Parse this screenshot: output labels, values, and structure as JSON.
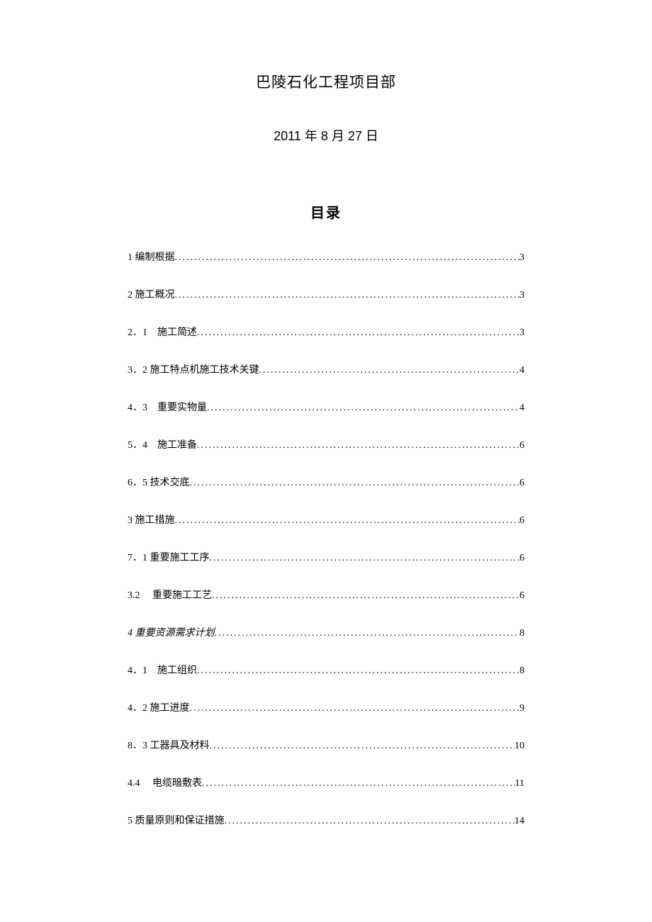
{
  "header": {
    "line1": "巴陵石化工程项目部",
    "line2": "2011 年 8 月 27 日"
  },
  "toc": {
    "title": "目录",
    "items": [
      {
        "label": "1 编制根据",
        "page": "3",
        "italic": false
      },
      {
        "label": "2 施工概况",
        "page": "3",
        "italic": false
      },
      {
        "label": "2．1　施工简述 ",
        "page": "3",
        "italic": false
      },
      {
        "label": "3．2 施工特点机施工技术关键",
        "page": "4",
        "italic": false
      },
      {
        "label": "4．3　重要实物量 ",
        "page": "4",
        "italic": false
      },
      {
        "label": "5．4　施工准备 ",
        "page": "6",
        "italic": false
      },
      {
        "label": "6．5 技术交底",
        "page": "6",
        "italic": false
      },
      {
        "label": "3 施工措施",
        "page": "6",
        "italic": false
      },
      {
        "label": "7．1 重要施工工序",
        "page": "6",
        "italic": false
      },
      {
        "label": "3.2　 重要施工工艺 ",
        "page": "6",
        "italic": false
      },
      {
        "label": "4 重要资源需求计划",
        "page": "8",
        "italic": true
      },
      {
        "label": "4．1　施工组织 ",
        "page": "8",
        "italic": false
      },
      {
        "label": "4．2 施工进度",
        "page": "9",
        "italic": false
      },
      {
        "label": "8．3 工器具及材料",
        "page": "10",
        "italic": false
      },
      {
        "label": "4.4　 电缆暗敷表 ",
        "page": "11",
        "italic": false
      },
      {
        "label": "5 质量原则和保证措施",
        "page": "14",
        "italic": false
      }
    ]
  }
}
